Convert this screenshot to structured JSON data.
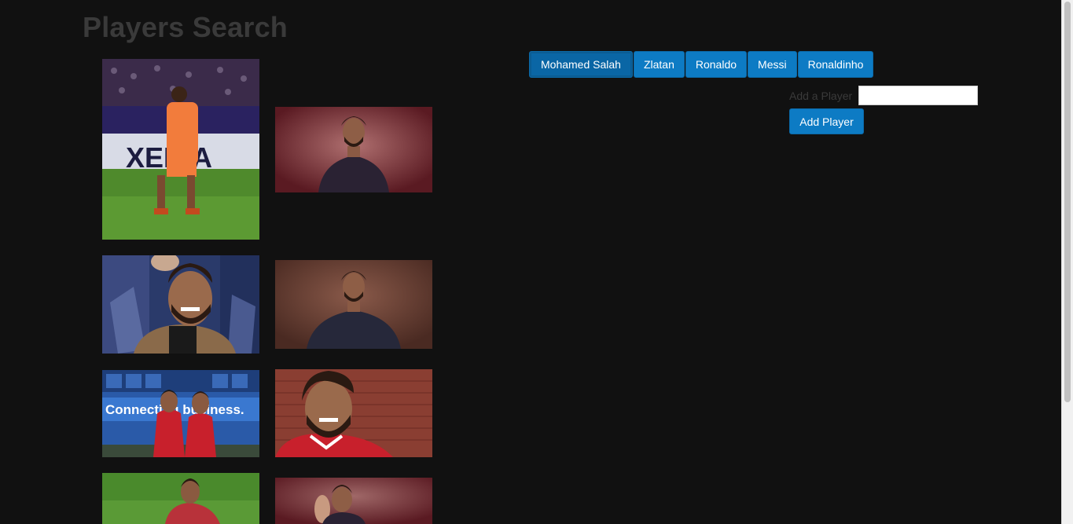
{
  "page": {
    "title": "Players Search"
  },
  "players": [
    "Mohamed Salah",
    "Zlatan",
    "Ronaldo",
    "Messi",
    "Ronaldinho"
  ],
  "active_player": "Mohamed Salah",
  "add_form": {
    "label": "Add a Player",
    "input_value": "",
    "button_label": "Add Player"
  },
  "photos": [
    {
      "subject": "salah-liverpool-away-kit-celebrating",
      "banner_text": "XERIA"
    },
    {
      "subject": "salah-roma-portrait-red-background"
    },
    {
      "subject": "salah-smiling-in-stands"
    },
    {
      "subject": "salah-roma-portrait-wall"
    },
    {
      "subject": "firmino-and-salah-celebrating",
      "banner_text": "Connecting business."
    },
    {
      "subject": "salah-smiling-brick-wall"
    },
    {
      "subject": "salah-on-pitch"
    },
    {
      "subject": "salah-waving-red-background"
    }
  ],
  "colors": {
    "background": "#111111",
    "button": "#0d7bc4",
    "title": "#3a3a3a"
  }
}
